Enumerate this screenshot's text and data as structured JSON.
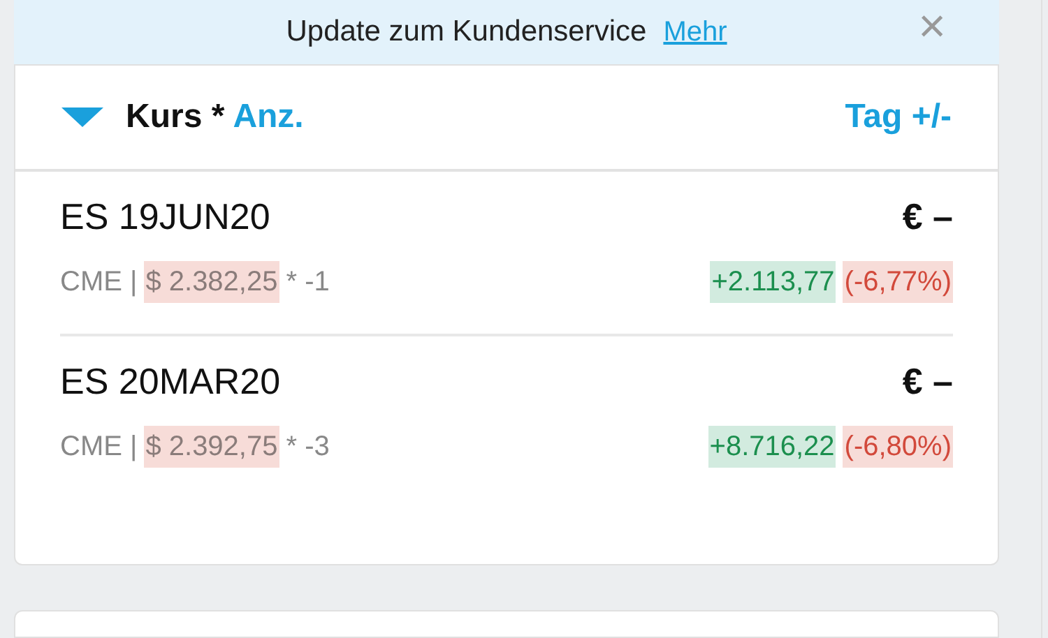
{
  "banner": {
    "text": "Update zum Kundenservice",
    "link": "Mehr",
    "close": "×"
  },
  "header": {
    "expanded": true,
    "sort_label": "Kurs *",
    "sort_secondary": "Anz.",
    "right_label": "Tag +/-"
  },
  "positions": [
    {
      "name": "ES 19JUN20",
      "value": "€ –",
      "exchange": "CME |",
      "price": "$ 2.382,25",
      "quantity": "* -1",
      "change": "+2.113,77",
      "change_pct": "(-6,77%)"
    },
    {
      "name": "ES 20MAR20",
      "value": "€ –",
      "exchange": "CME |",
      "price": "$ 2.392,75",
      "quantity": "* -3",
      "change": "+8.716,22",
      "change_pct": "(-6,80%)"
    }
  ]
}
